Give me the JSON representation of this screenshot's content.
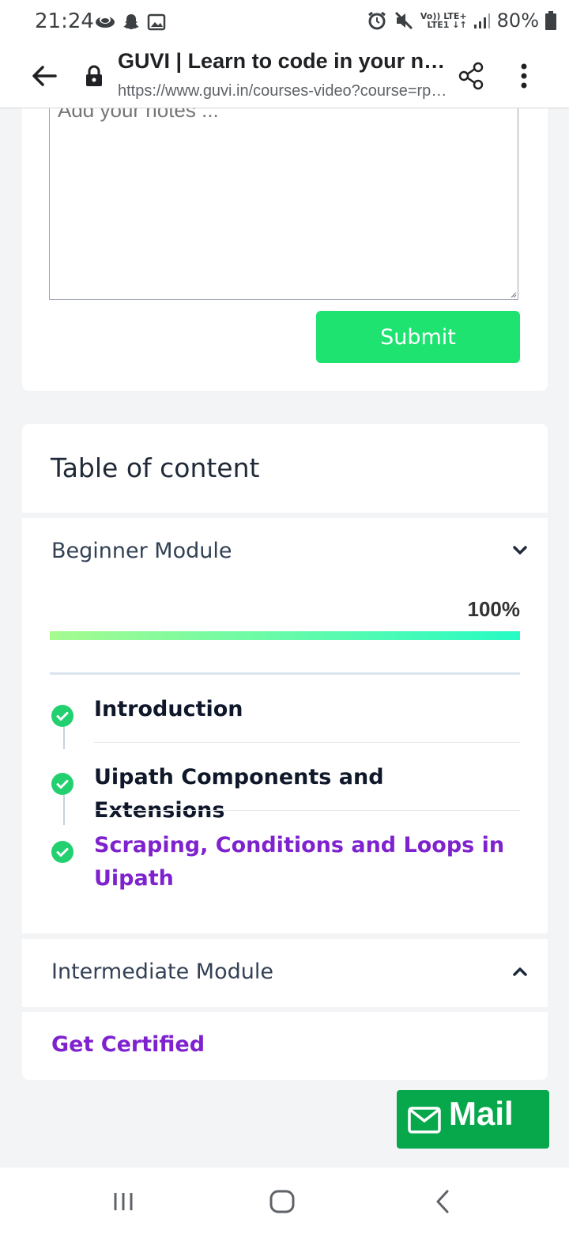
{
  "status_bar": {
    "time": "21:24",
    "left_icons": [
      "cloud-icon",
      "snapchat-icon",
      "image-icon"
    ],
    "right_icons": [
      "alarm-icon",
      "mute-icon",
      "volte-icon",
      "signal-icon",
      "battery-icon"
    ],
    "volte_line1": "Vo)) LTE+",
    "volte_line2": "LTE1 ↓↑",
    "battery": "80%"
  },
  "browser": {
    "title": "GUVI | Learn to code in your native language",
    "url": "https://www.guvi.in/courses-video?course=rpa-uipath"
  },
  "notes": {
    "placeholder": "Add your notes ...",
    "submit_label": "Submit"
  },
  "toc": {
    "title": "Table of content"
  },
  "modules": [
    {
      "title": "Beginner Module",
      "expanded": true,
      "progress_label": "100%",
      "progress": 1.0,
      "lessons": [
        {
          "label": "Introduction",
          "completed": true,
          "current": false
        },
        {
          "label": "Uipath Components and Extensions",
          "completed": true,
          "current": false
        },
        {
          "label": "Scraping, Conditions and Loops in Uipath",
          "completed": true,
          "current": true
        }
      ]
    },
    {
      "title": "Intermediate Module",
      "expanded": false
    }
  ],
  "certified": {
    "label": "Get Certified"
  },
  "mail": {
    "label": "Mail"
  },
  "colors": {
    "accent_green": "#1ee371",
    "mail_green": "#07a74c",
    "link_purple": "#7e22ce",
    "check_green": "#22d06f"
  }
}
